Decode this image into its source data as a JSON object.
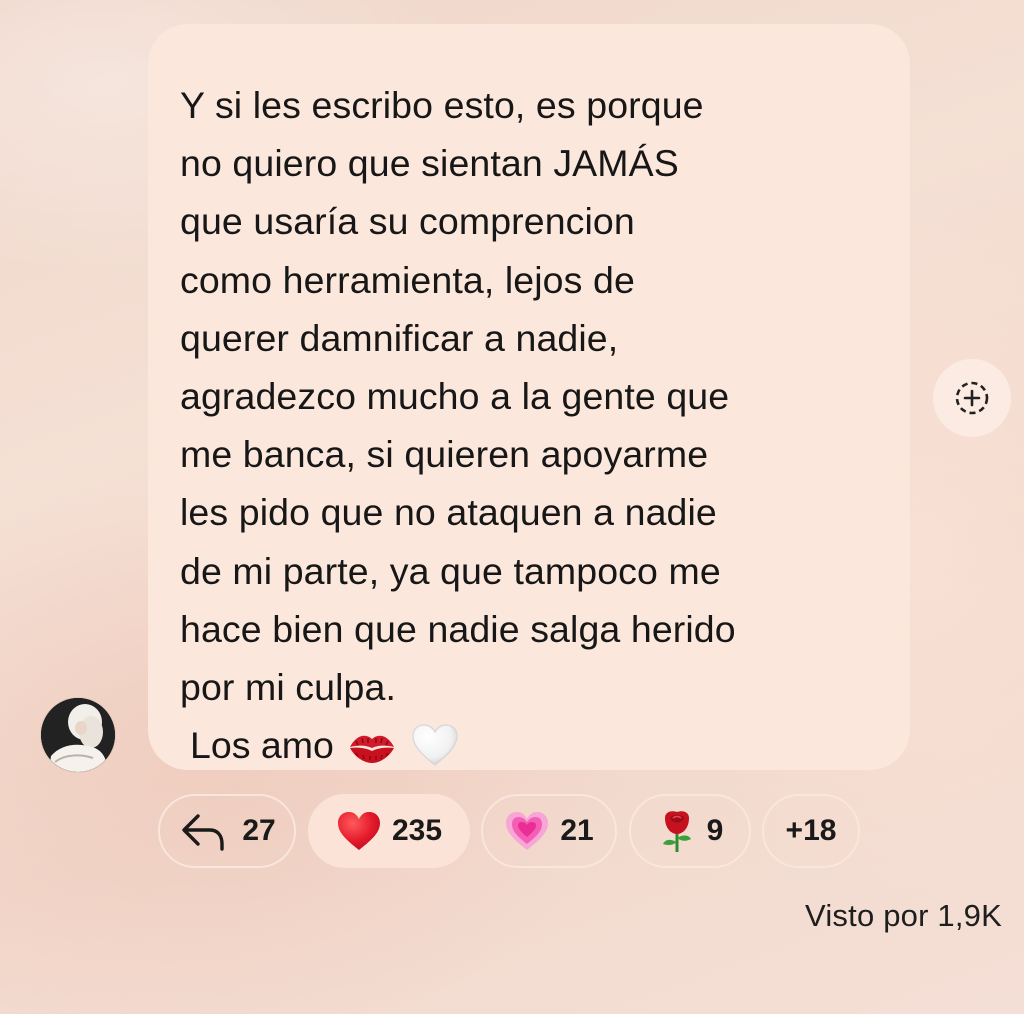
{
  "message": {
    "text": "Y si les escribo esto, es porque\nno quiero que sientan JAMÁS\nque usaría su comprencion\ncomo herramienta, lejos de\nquerer damnificar a nadie,\nagradezco mucho a la gente que\nme banca, si quieren apoyarme\nles pido que no ataquen a nadie\nde mi parte, ya que tampoco me\nhace bien que nadie salga herido\npor mi culpa.",
    "signoff": "Los amo",
    "signoff_emojis": [
      "kiss-mark-icon",
      "white-heart-icon"
    ]
  },
  "sender": {
    "avatar_icon": "profile-avatar"
  },
  "add_reaction": {
    "icon": "add-reaction-icon"
  },
  "reactions": [
    {
      "icon": "reply-arrow-icon",
      "count": "27"
    },
    {
      "icon": "red-heart-icon",
      "count": "235",
      "active": true
    },
    {
      "icon": "sparkling-heart-icon",
      "count": "21"
    },
    {
      "icon": "rose-icon",
      "count": "9"
    },
    {
      "icon": "",
      "count": "+18"
    }
  ],
  "seen_by": "Visto por 1,9K",
  "colors": {
    "bubble": "#fbe7dc",
    "text": "#171717",
    "heart_red": "#e3192b",
    "pink_heart": "#f45fb6"
  }
}
